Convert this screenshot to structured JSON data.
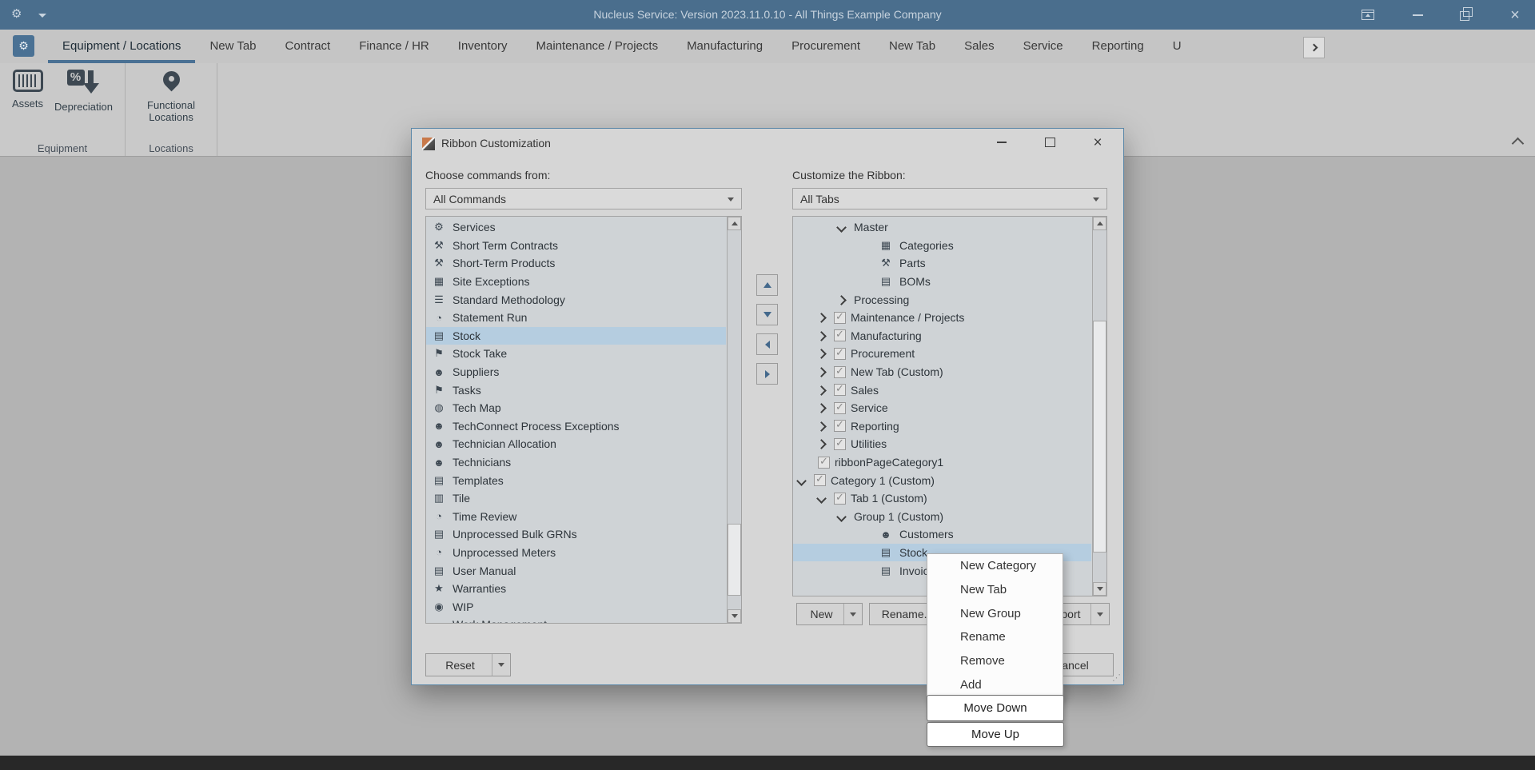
{
  "titlebar": {
    "title": "Nucleus Service: Version 2023.11.0.10 - All Things Example Company"
  },
  "tabs": [
    {
      "label": "Equipment / Locations",
      "active": true
    },
    {
      "label": "New Tab"
    },
    {
      "label": "Contract"
    },
    {
      "label": "Finance / HR"
    },
    {
      "label": "Inventory"
    },
    {
      "label": "Maintenance / Projects"
    },
    {
      "label": "Manufacturing"
    },
    {
      "label": "Procurement"
    },
    {
      "label": "New Tab"
    },
    {
      "label": "Sales"
    },
    {
      "label": "Service"
    },
    {
      "label": "Reporting"
    },
    {
      "label": "U"
    }
  ],
  "ribbon": {
    "groups": [
      {
        "label": "Equipment",
        "buttons": [
          {
            "label": "Assets",
            "icon": "barcode"
          },
          {
            "label": "Depreciation",
            "icon": "percent-down"
          }
        ]
      },
      {
        "label": "Locations",
        "buttons": [
          {
            "label": "Functional Locations",
            "icon": "map-pin"
          }
        ]
      }
    ]
  },
  "dialog": {
    "title": "Ribbon Customization",
    "choose_label": "Choose commands from:",
    "choose_value": "All Commands",
    "customize_label": "Customize the Ribbon:",
    "customize_value": "All Tabs",
    "commands": [
      {
        "label": "Services",
        "icon": "services"
      },
      {
        "label": "Short Term Contracts",
        "icon": "contract"
      },
      {
        "label": "Short-Term Products",
        "icon": "contract"
      },
      {
        "label": "Site Exceptions",
        "icon": "calendar"
      },
      {
        "label": "Standard Methodology",
        "icon": "methodology"
      },
      {
        "label": "Statement Run",
        "icon": "run"
      },
      {
        "label": "Stock",
        "icon": "stock",
        "selected": true
      },
      {
        "label": "Stock Take",
        "icon": "stocktake"
      },
      {
        "label": "Suppliers",
        "icon": "people"
      },
      {
        "label": "Tasks",
        "icon": "task"
      },
      {
        "label": "Tech Map",
        "icon": "globe"
      },
      {
        "label": "TechConnect Process Exceptions",
        "icon": "person-alert"
      },
      {
        "label": "Technician Allocation",
        "icon": "person-arrows"
      },
      {
        "label": "Technicians",
        "icon": "people"
      },
      {
        "label": "Templates",
        "icon": "doc"
      },
      {
        "label": "Tile",
        "icon": "tile"
      },
      {
        "label": "Time Review",
        "icon": "clock"
      },
      {
        "label": "Unprocessed Bulk GRNs",
        "icon": "doc"
      },
      {
        "label": "Unprocessed Meters",
        "icon": "meter"
      },
      {
        "label": "User Manual",
        "icon": "book"
      },
      {
        "label": "Warranties",
        "icon": "award"
      },
      {
        "label": "WIP",
        "icon": "wip"
      },
      {
        "label": "Work Management",
        "icon": "truck"
      }
    ],
    "tree": [
      {
        "indent": 2,
        "chevron": "down",
        "label": "Master"
      },
      {
        "indent": 4,
        "icon": "categories",
        "label": "Categories"
      },
      {
        "indent": 4,
        "icon": "parts",
        "label": "Parts"
      },
      {
        "indent": 4,
        "icon": "boms",
        "label": "BOMs"
      },
      {
        "indent": 2,
        "chevron": "right",
        "label": "Processing"
      },
      {
        "indent": 1,
        "chevron": "right",
        "checkbox": true,
        "label": "Maintenance / Projects"
      },
      {
        "indent": 1,
        "chevron": "right",
        "checkbox": true,
        "label": "Manufacturing"
      },
      {
        "indent": 1,
        "chevron": "right",
        "checkbox": true,
        "label": "Procurement"
      },
      {
        "indent": 1,
        "chevron": "right",
        "checkbox": true,
        "label": "New Tab (Custom)"
      },
      {
        "indent": 1,
        "chevron": "right",
        "checkbox": true,
        "label": "Sales"
      },
      {
        "indent": 1,
        "chevron": "right",
        "checkbox": true,
        "label": "Service"
      },
      {
        "indent": 1,
        "chevron": "right",
        "checkbox": true,
        "label": "Reporting"
      },
      {
        "indent": 1,
        "chevron": "right",
        "checkbox": true,
        "label": "Utilities"
      },
      {
        "indent": 1,
        "checkbox": true,
        "label": "ribbonPageCategory1"
      },
      {
        "indent": 0,
        "chevron": "down",
        "checkbox": true,
        "label": "Category 1 (Custom)"
      },
      {
        "indent": 1,
        "chevron": "down",
        "checkbox": true,
        "label": "Tab 1 (Custom)"
      },
      {
        "indent": 2,
        "chevron": "down",
        "label": "Group 1 (Custom)"
      },
      {
        "indent": 4,
        "icon": "customers",
        "label": "Customers"
      },
      {
        "indent": 4,
        "icon": "stock",
        "label": "Stock",
        "selected": true
      },
      {
        "indent": 4,
        "icon": "invoice",
        "label": "Invoices"
      }
    ],
    "buttons": {
      "new": "New",
      "rename": "Rename...",
      "import_export": "Import/Export",
      "reset": "Reset",
      "cancel": "Cancel"
    }
  },
  "context_menu": {
    "items": [
      "New Category",
      "New Tab",
      "New Group",
      "Rename",
      "Remove",
      "Add"
    ]
  },
  "float_buttons": {
    "move_down": "Move Down",
    "move_up": "Move Up"
  },
  "icon_map": {
    "services": "⚙",
    "contract": "⚒",
    "calendar": "▦",
    "methodology": "☰",
    "run": "◔",
    "stock": "▤",
    "stocktake": "⚑",
    "people": "☻",
    "task": "⚑",
    "globe": "◍",
    "person-alert": "☻",
    "person-arrows": "☻",
    "doc": "▤",
    "tile": "▥",
    "clock": "◔",
    "meter": "◔",
    "book": "▤",
    "award": "★",
    "wip": "◉",
    "truck": "▬",
    "categories": "▦",
    "parts": "⚒",
    "boms": "▤",
    "customers": "☻",
    "invoice": "▤",
    "check": "✓"
  }
}
